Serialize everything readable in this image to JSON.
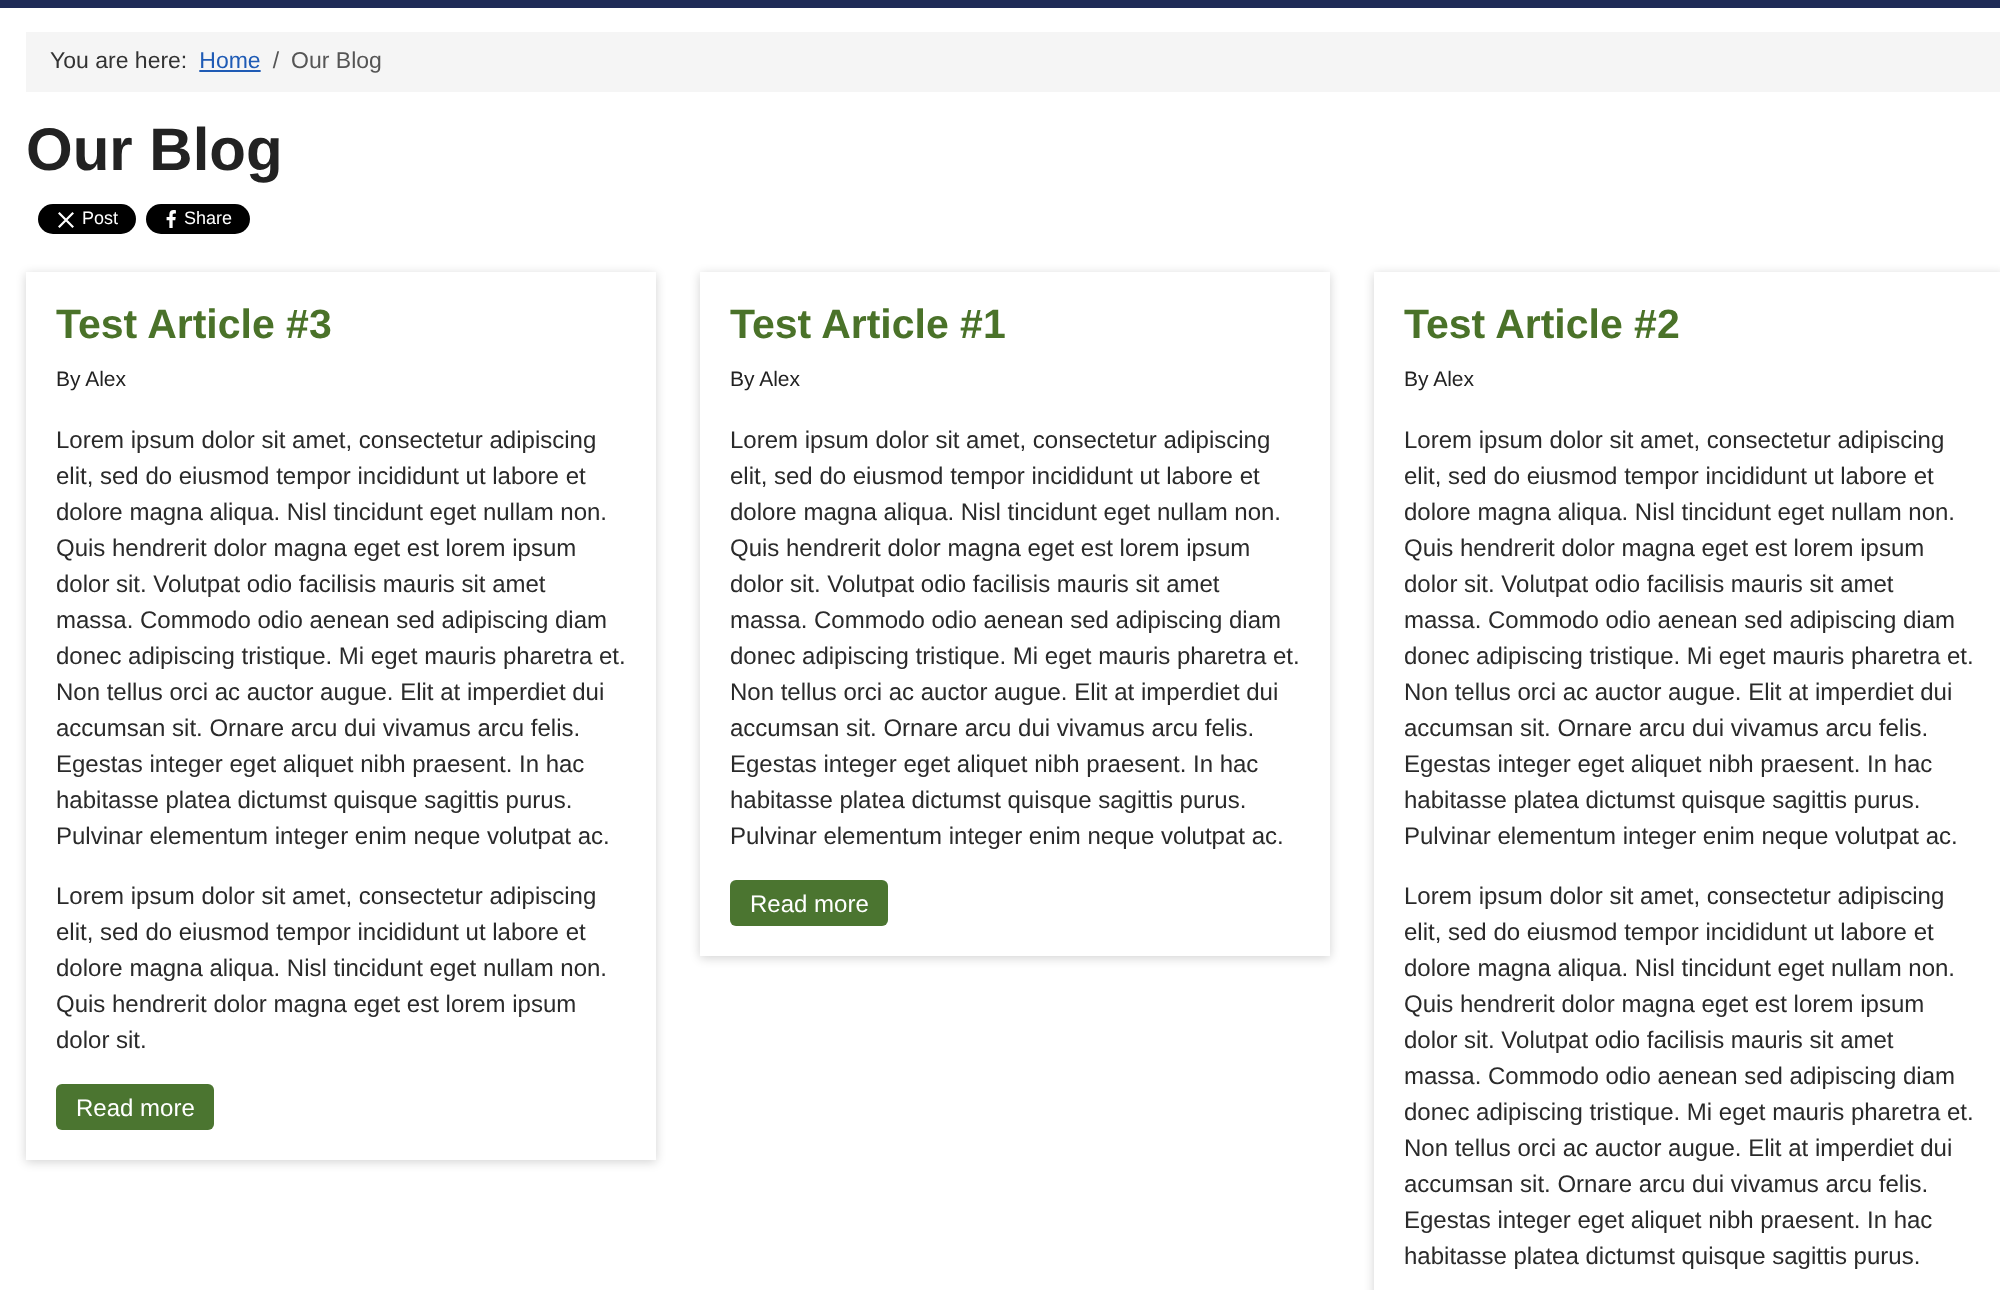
{
  "breadcrumb": {
    "label": "You are here:",
    "separator": "/",
    "items": [
      {
        "kind": "link",
        "text": "Home"
      },
      {
        "kind": "current",
        "text": "Our Blog"
      }
    ]
  },
  "page_title": "Our Blog",
  "share_buttons": [
    {
      "kind": "x",
      "label": "Post"
    },
    {
      "kind": "f",
      "label": "Share"
    }
  ],
  "articles": [
    {
      "title": "Test Article #3",
      "byline": "By Alex",
      "paragraphs": [
        "Lorem ipsum dolor sit amet, consectetur adipiscing elit, sed do eiusmod tempor incididunt ut labore et dolore magna aliqua. Nisl tincidunt eget nullam non. Quis hendrerit dolor magna eget est lorem ipsum dolor sit. Volutpat odio facilisis mauris sit amet massa. Commodo odio aenean sed adipiscing diam donec adipiscing tristique. Mi eget mauris pharetra et. Non tellus orci ac auctor augue. Elit at imperdiet dui accumsan sit. Ornare arcu dui vivamus arcu felis. Egestas integer eget aliquet nibh praesent. In hac habitasse platea dictumst quisque sagittis purus. Pulvinar elementum integer enim neque volutpat ac.",
        "Lorem ipsum dolor sit amet, consectetur adipiscing elit, sed do eiusmod tempor incididunt ut labore et dolore magna aliqua. Nisl tincidunt eget nullam non. Quis hendrerit dolor magna eget est lorem ipsum dolor sit."
      ],
      "read_more": "Read more"
    },
    {
      "title": "Test Article #1",
      "byline": "By Alex",
      "paragraphs": [
        "Lorem ipsum dolor sit amet, consectetur adipiscing elit, sed do eiusmod tempor incididunt ut labore et dolore magna aliqua. Nisl tincidunt eget nullam non. Quis hendrerit dolor magna eget est lorem ipsum dolor sit. Volutpat odio facilisis mauris sit amet massa. Commodo odio aenean sed adipiscing diam donec adipiscing tristique. Mi eget mauris pharetra et. Non tellus orci ac auctor augue. Elit at imperdiet dui accumsan sit. Ornare arcu dui vivamus arcu felis. Egestas integer eget aliquet nibh praesent. In hac habitasse platea dictumst quisque sagittis purus. Pulvinar elementum integer enim neque volutpat ac."
      ],
      "read_more": "Read more"
    },
    {
      "title": "Test Article #2",
      "byline": "By Alex",
      "paragraphs": [
        "Lorem ipsum dolor sit amet, consectetur adipiscing elit, sed do eiusmod tempor incididunt ut labore et dolore magna aliqua. Nisl tincidunt eget nullam non. Quis hendrerit dolor magna eget est lorem ipsum dolor sit. Volutpat odio facilisis mauris sit amet massa. Commodo odio aenean sed adipiscing diam donec adipiscing tristique. Mi eget mauris pharetra et. Non tellus orci ac auctor augue. Elit at imperdiet dui accumsan sit. Ornare arcu dui vivamus arcu felis. Egestas integer eget aliquet nibh praesent. In hac habitasse platea dictumst quisque sagittis purus. Pulvinar elementum integer enim neque volutpat ac.",
        "Lorem ipsum dolor sit amet, consectetur adipiscing elit, sed do eiusmod tempor incididunt ut labore et dolore magna aliqua. Nisl tincidunt eget nullam non. Quis hendrerit dolor magna eget est lorem ipsum dolor sit. Volutpat odio facilisis mauris sit amet massa. Commodo odio aenean sed adipiscing diam donec adipiscing tristique. Mi eget mauris pharetra et. Non tellus orci ac auctor augue. Elit at imperdiet dui accumsan sit. Ornare arcu dui vivamus arcu felis. Egestas integer eget aliquet nibh praesent. In hac habitasse platea dictumst quisque sagittis purus."
      ]
    }
  ]
}
